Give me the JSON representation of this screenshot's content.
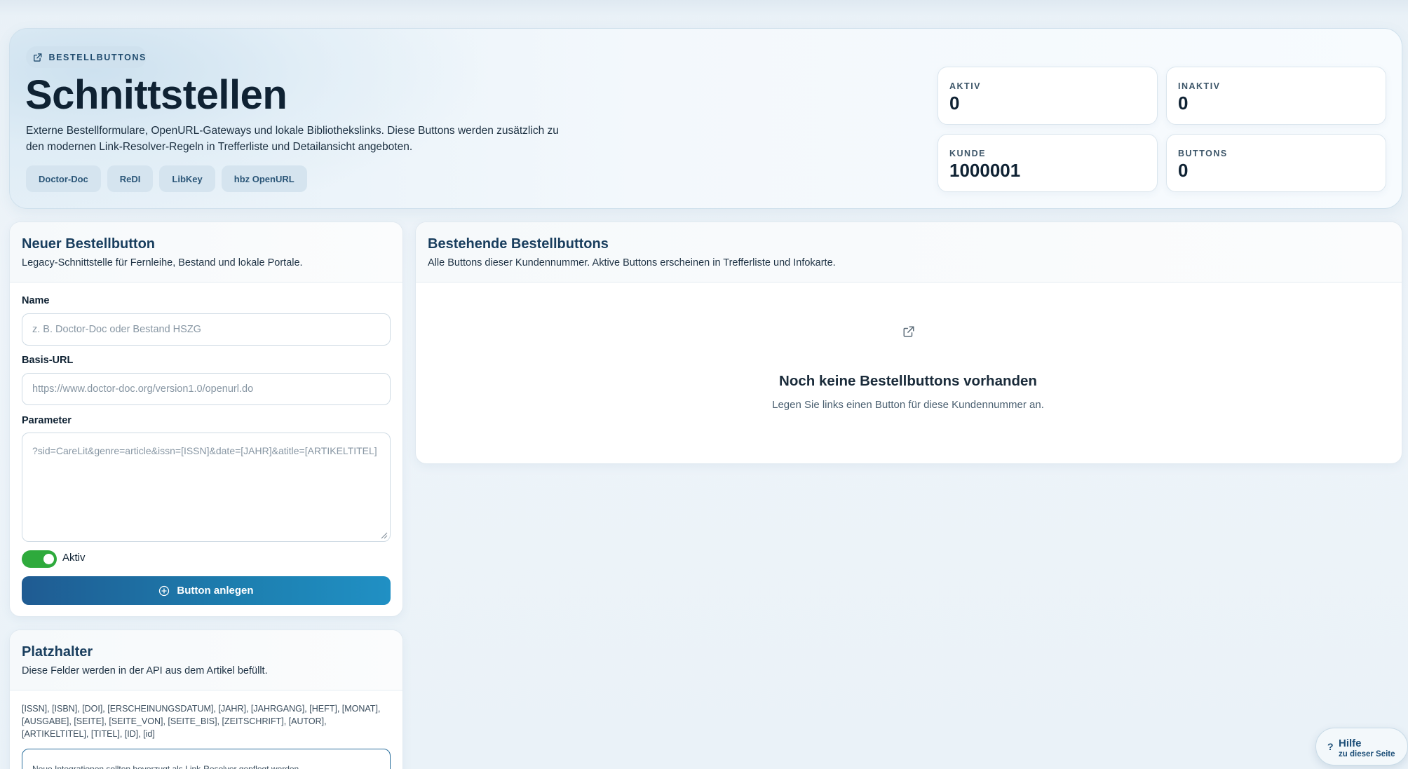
{
  "hero": {
    "eyebrow": "BESTELLBUTTONS",
    "title": "Schnittstellen",
    "description": "Externe Bestellformulare, OpenURL-Gateways und lokale Bibliothekslinks. Diese Buttons werden zusätzlich zu den modernen Link-Resolver-Regeln in Trefferliste und Detailansicht angeboten.",
    "chips": [
      "Doctor-Doc",
      "ReDI",
      "LibKey",
      "hbz OpenURL"
    ]
  },
  "stats": {
    "aktiv": {
      "label": "AKTIV",
      "value": "0"
    },
    "inaktiv": {
      "label": "INAKTIV",
      "value": "0"
    },
    "kunde": {
      "label": "KUNDE",
      "value": "1000001"
    },
    "buttons": {
      "label": "BUTTONS",
      "value": "0"
    }
  },
  "new_button": {
    "title": "Neuer Bestellbutton",
    "subtitle": "Legacy-Schnittstelle für Fernleihe, Bestand und lokale Portale.",
    "name_label": "Name",
    "name_placeholder": "z. B. Doctor-Doc oder Bestand HSZG",
    "url_label": "Basis-URL",
    "url_placeholder": "https://www.doctor-doc.org/version1.0/openurl.do",
    "params_label": "Parameter",
    "params_placeholder": "?sid=CareLit&genre=article&issn=[ISSN]&date=[JAHR]&atitle=[ARTIKELTITEL]",
    "active_label": "Aktiv",
    "active": true,
    "submit_label": "Button anlegen"
  },
  "placeholders": {
    "title": "Platzhalter",
    "subtitle": "Diese Felder werden in der API aus dem Artikel befüllt.",
    "list": "[ISSN], [ISBN], [DOI], [ERSCHEINUNGSDATUM], [JAHR], [JAHRGANG], [HEFT], [MONAT], [AUSGABE], [SEITE], [SEITE_VON], [SEITE_BIS], [ZEITSCHRIFT], [AUTOR], [ARTIKELTITEL], [TITEL], [ID], [id]",
    "note": "Neue Integrationen sollten bevorzugt als Link-Resolver gepflegt werden."
  },
  "existing": {
    "title": "Bestehende Bestellbuttons",
    "subtitle": "Alle Buttons dieser Kundennummer. Aktive Buttons erscheinen in Trefferliste und Infokarte.",
    "empty_title": "Noch keine Bestellbuttons vorhanden",
    "empty_sub": "Legen Sie links einen Button für diese Kundennummer an."
  },
  "help": {
    "label": "Hilfe",
    "sub": "zu dieser Seite",
    "icon": "?"
  },
  "colors": {
    "accent": "#1f5b92",
    "toggle_on": "#2eaa3c",
    "title": "#193e5e"
  }
}
